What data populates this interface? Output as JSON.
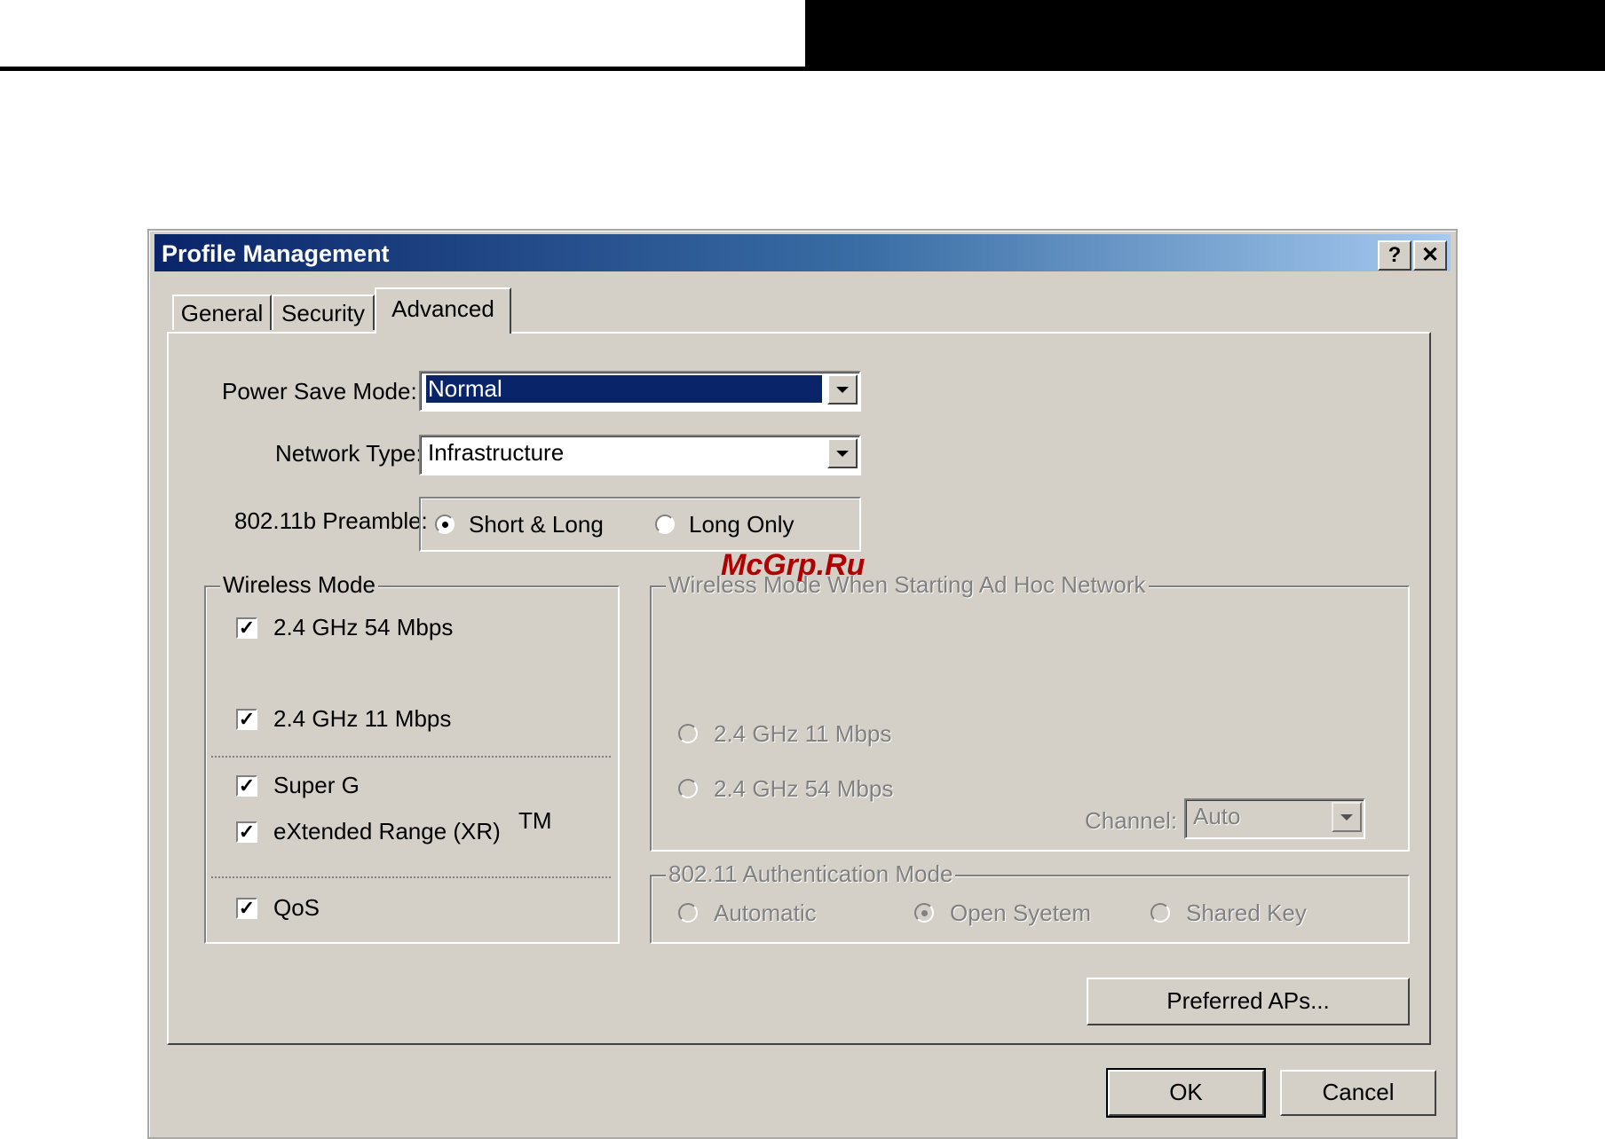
{
  "dialog": {
    "title": "Profile Management",
    "help_glyph": "?",
    "close_glyph": "✕"
  },
  "tabs": [
    {
      "label": "General"
    },
    {
      "label": "Security"
    },
    {
      "label": "Advanced",
      "active": true
    }
  ],
  "power_save": {
    "label": "Power Save Mode:",
    "value": "Normal"
  },
  "network_type": {
    "label": "Network Type:",
    "value": "Infrastructure"
  },
  "preamble": {
    "label": "802.11b Preamble:",
    "options": [
      {
        "label": "Short & Long",
        "checked": true
      },
      {
        "label": "Long Only",
        "checked": false
      }
    ]
  },
  "wireless_mode": {
    "legend": "Wireless Mode",
    "items": [
      {
        "label": "2.4 GHz 54 Mbps",
        "checked": true
      },
      {
        "label": "2.4 GHz 11 Mbps",
        "checked": true
      },
      {
        "label": "Super G",
        "checked": true
      },
      {
        "label": "eXtended Range (XR)",
        "checked": true
      },
      {
        "label": "QoS",
        "checked": true
      }
    ],
    "tm": "TM"
  },
  "adhoc": {
    "legend": "Wireless Mode When Starting Ad Hoc Network",
    "options": [
      {
        "label": "2.4 GHz 11 Mbps",
        "checked": false
      },
      {
        "label": "2.4 GHz 54 Mbps",
        "checked": false
      }
    ],
    "channel_label": "Channel:",
    "channel_value": "Auto"
  },
  "auth": {
    "legend": "802.11 Authentication Mode",
    "options": [
      {
        "label": "Automatic",
        "checked": false
      },
      {
        "label": "Open Syetem",
        "checked": true
      },
      {
        "label": "Shared Key",
        "checked": false
      }
    ]
  },
  "buttons": {
    "preferred": "Preferred APs...",
    "ok": "OK",
    "cancel": "Cancel"
  },
  "watermark": "McGrp.Ru",
  "colors": {
    "face": "#d4d0c8",
    "title_start": "#0a246a",
    "title_end": "#a6caf0",
    "highlight": "#0a246a"
  }
}
